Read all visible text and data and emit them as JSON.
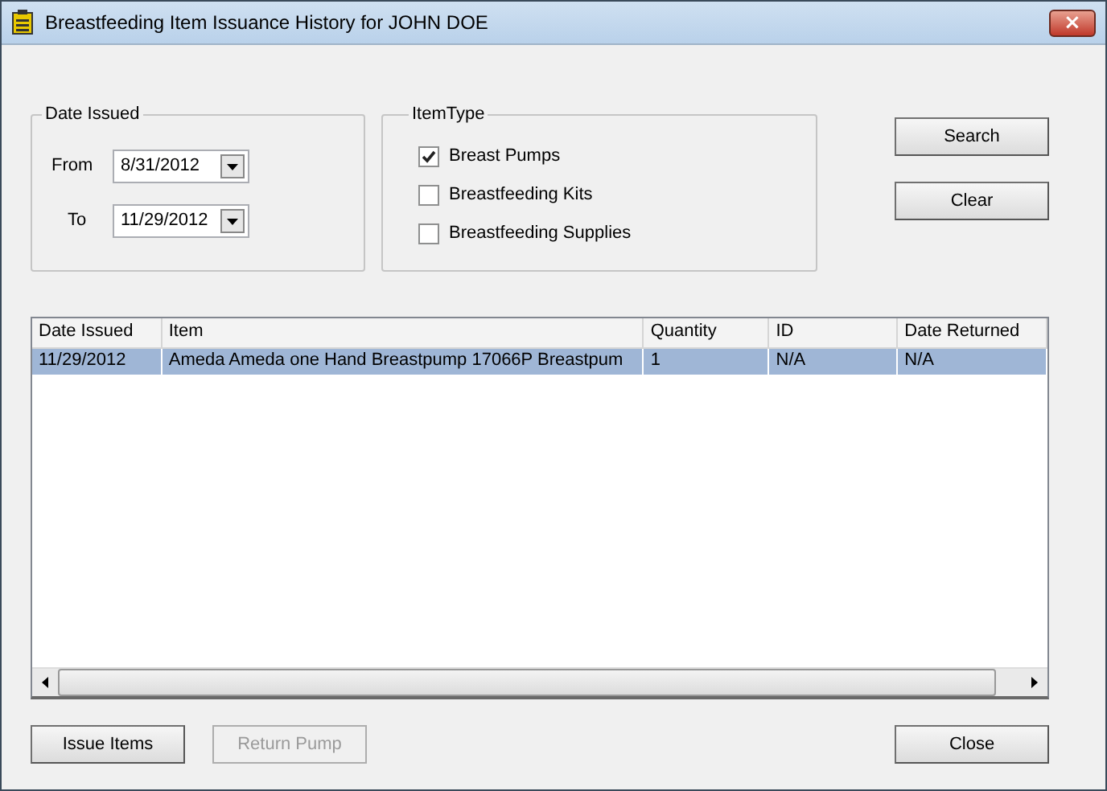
{
  "window": {
    "title": "Breastfeeding Item Issuance History for JOHN DOE",
    "close": "×"
  },
  "date_issued": {
    "label": "Date Issued",
    "from_label": "From",
    "from": "8/31/2012",
    "to_label": "To",
    "to": "11/29/2012"
  },
  "item_type": {
    "label": "ItemType",
    "options": [
      {
        "label": "Breast Pumps",
        "checked": true
      },
      {
        "label": "Breastfeeding Kits",
        "checked": false
      },
      {
        "label": "Breastfeeding Supplies",
        "checked": false
      }
    ]
  },
  "side_buttons": [
    {
      "label": "Search",
      "disabled": false
    },
    {
      "label": "Clear",
      "disabled": false
    }
  ],
  "table": {
    "columns": [
      "Date Issued",
      "Item",
      "Quantity",
      "ID",
      "Date Returned"
    ],
    "rows": [
      {
        "cells": [
          "11/29/2012",
          "Ameda Ameda one  Hand Breastpump 17066P Breastpum",
          "1",
          "N/A",
          "N/A"
        ],
        "selected": true
      }
    ]
  },
  "bottom_buttons": [
    {
      "label": "Issue Items",
      "disabled": false
    },
    {
      "label": "Return Pump",
      "disabled": true
    }
  ],
  "close_button": {
    "label": "Close"
  }
}
